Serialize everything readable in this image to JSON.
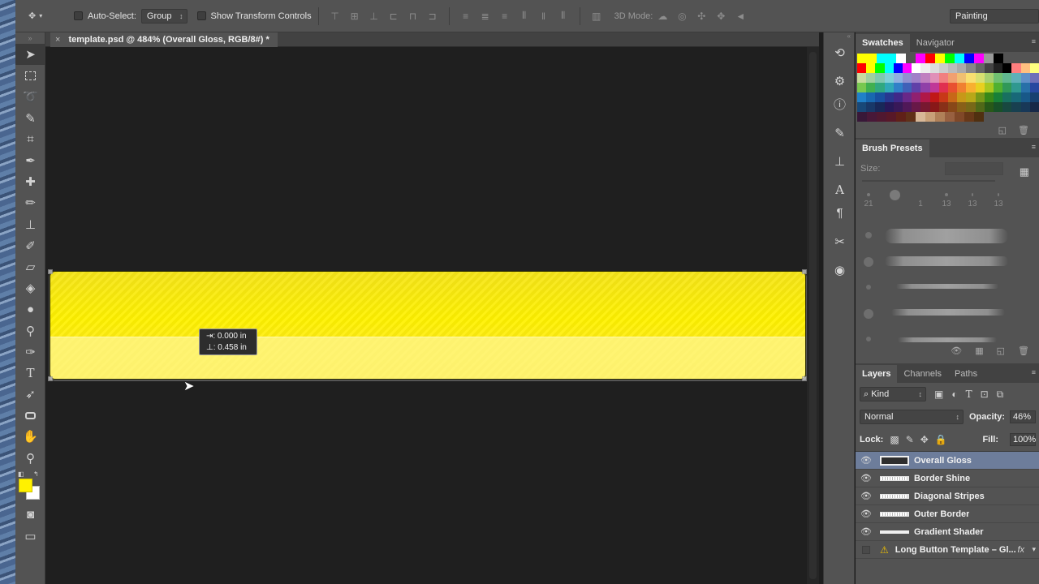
{
  "options_bar": {
    "auto_select_label": "Auto-Select:",
    "auto_select_value": "Group",
    "show_transform_label": "Show Transform Controls",
    "mode_3d_label": "3D Mode:",
    "workspace_value": "Painting"
  },
  "document": {
    "tab_title": "template.psd @ 484% (Overall Gloss, RGB/8#) *",
    "close_glyph": "×",
    "measure_x": "⇥: 0.000 in",
    "measure_y": "⊥: 0.458 in"
  },
  "colors": {
    "foreground": "#fff100",
    "background": "#ffffff",
    "button_yellow": "#fff200",
    "selected_layer": "#6d7d9b"
  },
  "panels": {
    "swatches_tab": "Swatches",
    "navigator_tab": "Navigator",
    "brush_presets_tab": "Brush Presets",
    "size_label": "Size:",
    "brush_tip_sizes": [
      "21",
      "",
      "1",
      "13",
      "13",
      "13"
    ],
    "layers_tab": "Layers",
    "channels_tab": "Channels",
    "paths_tab": "Paths"
  },
  "layers": {
    "kind_value": "Kind",
    "blend_mode": "Normal",
    "opacity_label": "Opacity:",
    "opacity_value": "46%",
    "lock_label": "Lock:",
    "fill_label": "Fill:",
    "fill_value": "100%",
    "items": [
      {
        "name": "Overall Gloss",
        "selected": true
      },
      {
        "name": "Border Shine",
        "selected": false
      },
      {
        "name": "Diagonal Stripes",
        "selected": false
      },
      {
        "name": "Outer Border",
        "selected": false
      },
      {
        "name": "Gradient Shader",
        "selected": false
      },
      {
        "name": "Long Button Template – Gl...",
        "selected": false
      }
    ],
    "fx_label": "fx"
  },
  "icons": [
    "move-icon",
    "marquee-icon",
    "lasso-icon",
    "quick-select-icon",
    "crop-icon",
    "eyedropper-icon",
    "healing-icon",
    "brush-icon",
    "stamp-icon",
    "history-brush-icon",
    "eraser-icon",
    "bucket-icon",
    "blur-icon",
    "dodge-icon",
    "pen-icon",
    "type-icon",
    "path-select-icon",
    "shape-icon",
    "hand-icon",
    "zoom-icon",
    "eye-icon",
    "warning-icon",
    "lock-icon"
  ]
}
